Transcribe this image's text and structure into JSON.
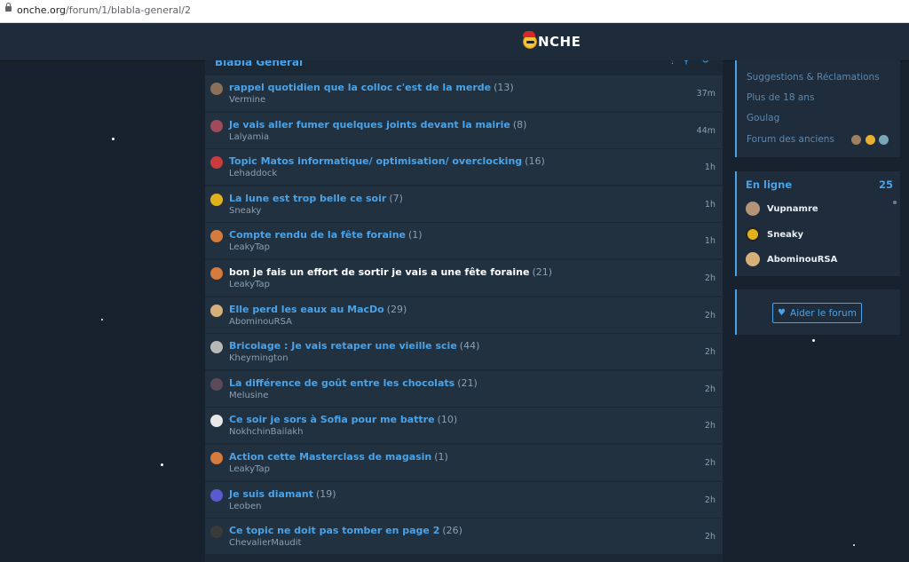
{
  "browser": {
    "url_host": "onche.org",
    "url_path": "/forum/1/blabla-general/2"
  },
  "header": {
    "logo_text": "NCHE"
  },
  "forum": {
    "title": "Blabla Général",
    "topics": [
      {
        "title": "rappel quotidien que la colloc c'est de la merde",
        "count": "(13)",
        "author": "Vermine",
        "time": "37m",
        "read": false,
        "avatar_color": "#8a7058"
      },
      {
        "title": "Je vais aller fumer quelques joints devant la mairie",
        "count": "(8)",
        "author": "Lalyamia",
        "time": "44m",
        "read": false,
        "avatar_color": "#a04a5a"
      },
      {
        "title": "Topic Matos informatique/ optimisation/ overclocking",
        "count": "(16)",
        "author": "Lehaddock",
        "time": "1h",
        "read": false,
        "avatar_color": "#c83c3c"
      },
      {
        "title": "La lune est trop belle ce soir",
        "count": "(7)",
        "author": "Sneaky",
        "time": "1h",
        "read": false,
        "avatar_color": "#e2b21c"
      },
      {
        "title": "Compte rendu de la fête foraine",
        "count": "(1)",
        "author": "LeakyTap",
        "time": "1h",
        "read": false,
        "avatar_color": "#d77a3c"
      },
      {
        "title": "bon je fais un effort de sortir je vais a une fête foraine",
        "count": "(21)",
        "author": "LeakyTap",
        "time": "2h",
        "read": true,
        "avatar_color": "#d77a3c"
      },
      {
        "title": "Elle perd les eaux au MacDo",
        "count": "(29)",
        "author": "AbominouRSA",
        "time": "2h",
        "read": false,
        "avatar_color": "#d6b078"
      },
      {
        "title": "Bricolage : Je vais retaper une vieille scie",
        "count": "(44)",
        "author": "Kheymington",
        "time": "2h",
        "read": false,
        "avatar_color": "#b8b8b8"
      },
      {
        "title": "La différence de goût entre les chocolats",
        "count": "(21)",
        "author": "Melusine",
        "time": "2h",
        "read": false,
        "avatar_color": "#5a4a5a"
      },
      {
        "title": "Ce soir je sors à Sofia pour me battre",
        "count": "(10)",
        "author": "NokhchinBailakh",
        "time": "2h",
        "read": false,
        "avatar_color": "#e8e8e8"
      },
      {
        "title": "Action cette Masterclass de magasin",
        "count": "(1)",
        "author": "LeakyTap",
        "time": "2h",
        "read": false,
        "avatar_color": "#d77a3c"
      },
      {
        "title": "Je suis diamant",
        "count": "(19)",
        "author": "Leoben",
        "time": "2h",
        "read": false,
        "avatar_color": "#5a5ad0"
      },
      {
        "title": "Ce topic ne doit pas tomber en page 2",
        "count": "(26)",
        "author": "ChevalierMaudit",
        "time": "2h",
        "read": false,
        "avatar_color": "#3a3a3a"
      }
    ]
  },
  "sidebar": {
    "categories": [
      "Suggestions & Réclamations",
      "Plus de 18 ans",
      "Goulag",
      "Forum des anciens"
    ],
    "online": {
      "title": "En ligne",
      "count": "25",
      "users": [
        {
          "name": "Vupnamre",
          "avatar_color": "#b49478"
        },
        {
          "name": "Sneaky",
          "avatar_color": "#e2b21c"
        },
        {
          "name": "AbominouRSA",
          "avatar_color": "#d6b078"
        }
      ]
    },
    "help_button": "Aider le forum"
  },
  "colors": {
    "accent": "#4aa3e8",
    "background": "#18222f",
    "row": "#22313f"
  }
}
